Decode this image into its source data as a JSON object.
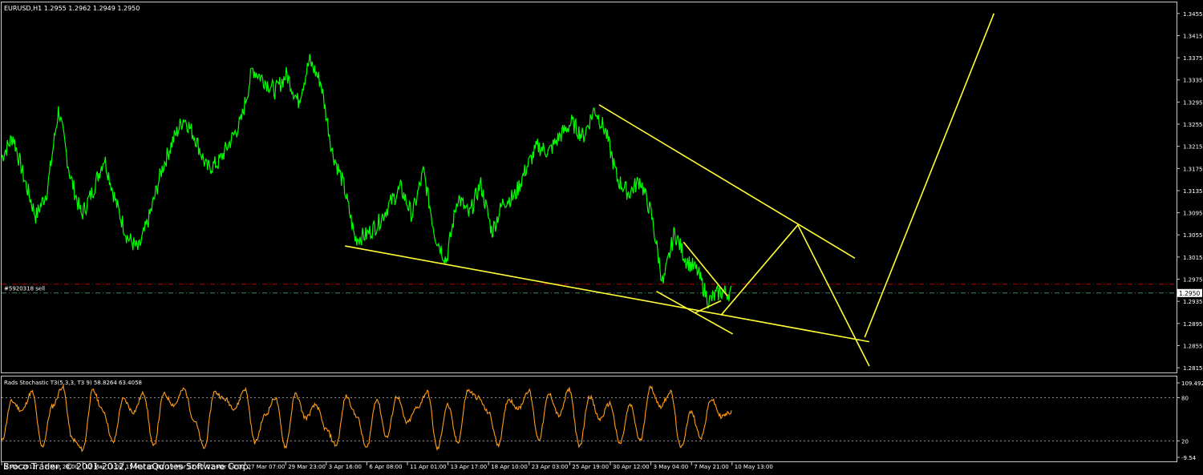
{
  "chart_data": [
    {
      "type": "line",
      "title": "EURUSD,H1  1.2955 1.2962 1.2949 1.2950",
      "symbol": "EURUSD,H1",
      "ohlc_readout": "1.2955 1.2962 1.2949 1.2950",
      "ylim": [
        1.2805,
        1.3475
      ],
      "y_ticks": [
        "1.3455",
        "1.3415",
        "1.3375",
        "1.3335",
        "1.3295",
        "1.3255",
        "1.3215",
        "1.3175",
        "1.3135",
        "1.3095",
        "1.3055",
        "1.3015",
        "1.2975",
        "1.2935",
        "1.2895",
        "1.2855",
        "1.2815"
      ],
      "current_price": 1.295,
      "current_price_label": "1.2950",
      "order_line": {
        "label": "#5920318 sell",
        "price": 1.2966,
        "color": "#c00000"
      },
      "bid_line_color": "#3a8a5a",
      "price_color": "#00ff00",
      "drawing_color": "#ffff33",
      "grid": false,
      "x_ticks": [
        "5 Mar 2012",
        "7 Mar 20:00",
        "12 Mar 13:00",
        "15 Mar 05:00",
        "19 Mar 22:00",
        "22 Mar 14:00",
        "27 Mar 07:00",
        "29 Mar 23:00",
        "3 Apr 16:00",
        "6 Apr 08:00",
        "11 Apr 01:00",
        "13 Apr 17:00",
        "18 Apr 10:00",
        "23 Apr 03:00",
        "25 Apr 19:00",
        "30 Apr 12:00",
        "3 May 04:00",
        "7 May 21:00",
        "10 May 13:00"
      ],
      "close_anchors": [
        1.3195,
        1.3233,
        1.3155,
        1.3088,
        1.3135,
        1.3283,
        1.3163,
        1.309,
        1.3135,
        1.3195,
        1.3115,
        1.3052,
        1.3028,
        1.309,
        1.317,
        1.3225,
        1.3267,
        1.323,
        1.3175,
        1.3185,
        1.3222,
        1.326,
        1.3355,
        1.3335,
        1.3315,
        1.3345,
        1.3295,
        1.337,
        1.333,
        1.3205,
        1.3145,
        1.3048,
        1.3055,
        1.3075,
        1.311,
        1.314,
        1.309,
        1.317,
        1.3055,
        1.3008,
        1.3125,
        1.309,
        1.3148,
        1.306,
        1.3115,
        1.3125,
        1.3175,
        1.3215,
        1.3205,
        1.3235,
        1.3258,
        1.3232,
        1.3283,
        1.324,
        1.3155,
        1.313,
        1.3155,
        1.309,
        1.2965,
        1.306,
        1.301,
        1.299,
        1.2935,
        1.2952,
        1.295
      ],
      "trendlines": [
        {
          "name": "wedge-lower",
          "p1": {
            "bar": 0.2923,
            "price": 1.3035
          },
          "p2": {
            "bar": 0.7385,
            "price": 1.2862
          }
        },
        {
          "name": "wedge-upper",
          "p1": {
            "bar": 0.5085,
            "price": 1.329
          },
          "p2": {
            "bar": 0.7262,
            "price": 1.3013
          }
        },
        {
          "name": "small-support",
          "p1": {
            "bar": 0.5573,
            "price": 1.2953
          },
          "p2": {
            "bar": 0.6223,
            "price": 1.2876
          }
        },
        {
          "name": "small-resistance",
          "p1": {
            "bar": 0.5804,
            "price": 1.3042
          },
          "p2": {
            "bar": 0.6177,
            "price": 1.2945
          }
        },
        {
          "name": "small-base",
          "p1": {
            "bar": 0.59,
            "price": 1.2914
          },
          "p2": {
            "bar": 0.6123,
            "price": 1.2936
          }
        },
        {
          "name": "projection-up",
          "p1": {
            "bar": 0.6123,
            "price": 1.291
          },
          "p2": {
            "bar": 0.6777,
            "price": 1.3073
          }
        },
        {
          "name": "projection-down",
          "p1": {
            "bar": 0.6777,
            "price": 1.3073
          },
          "p2": {
            "bar": 0.7385,
            "price": 1.2818
          }
        },
        {
          "name": "projection-rally",
          "p1": {
            "bar": 0.7346,
            "price": 1.287
          },
          "p2": {
            "bar": 0.8446,
            "price": 1.3455
          }
        }
      ]
    },
    {
      "type": "line",
      "title": "Rads Stochastic T3(5,3,3, T3 9) 58.8264 63.4058",
      "ylim": [
        -9.54,
        109.492
      ],
      "y_ticks": [
        "109.492",
        "80",
        "20",
        "-9.54"
      ],
      "levels": [
        80,
        20
      ],
      "line_color": "#ff9c1a",
      "value_anchors": [
        20,
        75,
        62,
        88,
        12,
        68,
        95,
        22,
        8,
        90,
        62,
        18,
        78,
        60,
        86,
        12,
        85,
        70,
        92,
        48,
        10,
        88,
        78,
        65,
        92,
        18,
        56,
        80,
        12,
        85,
        52,
        70,
        36,
        14,
        82,
        55,
        10,
        78,
        25,
        82,
        45,
        66,
        88,
        9,
        70,
        18,
        90,
        80,
        60,
        15,
        78,
        65,
        90,
        22,
        85,
        55,
        92,
        12,
        82,
        50,
        72,
        16,
        70,
        20,
        94,
        68,
        88,
        10,
        60,
        25,
        78,
        54,
        60
      ]
    }
  ],
  "footer": {
    "copyright": "Broco Trader, © 2001-2012, MetaQuotes Software Corp."
  }
}
